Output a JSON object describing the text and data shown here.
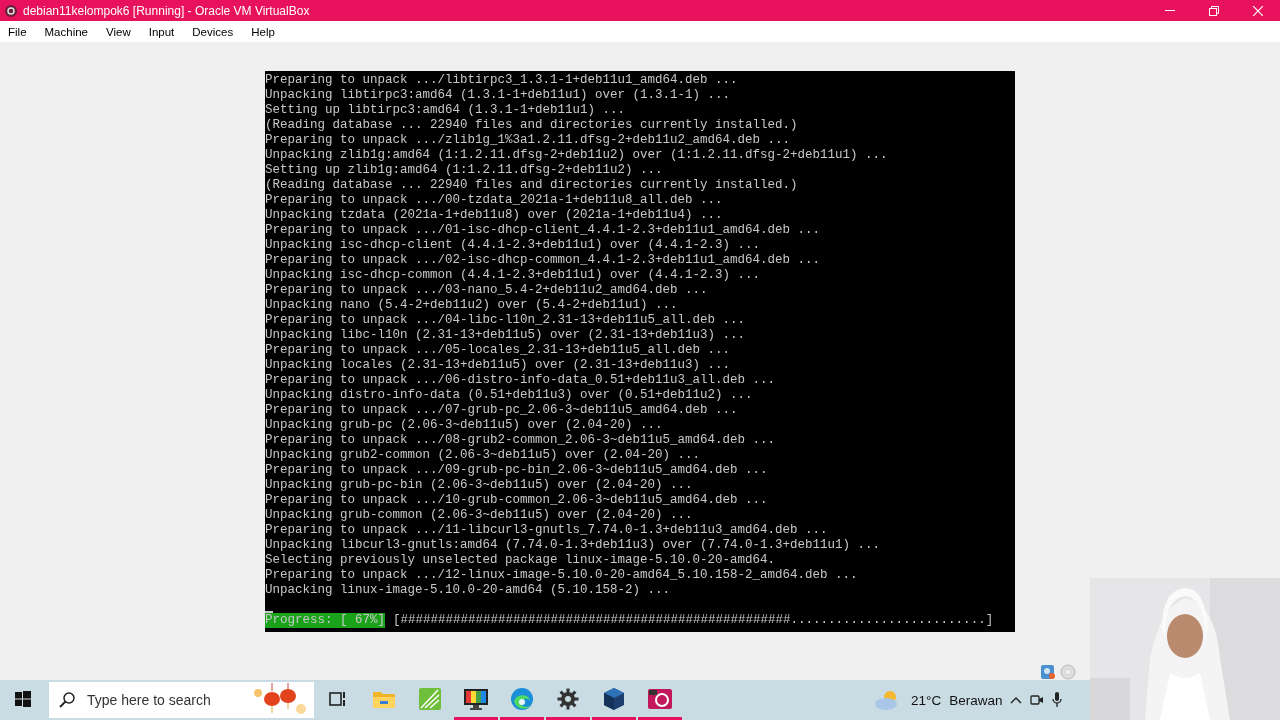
{
  "window": {
    "title": "debian11kelompok6 [Running] - Oracle VM VirtualBox"
  },
  "menu": [
    "File",
    "Machine",
    "View",
    "Input",
    "Devices",
    "Help"
  ],
  "terminal": {
    "lines": [
      "Preparing to unpack .../libtirpc3_1.3.1-1+deb11u1_amd64.deb ...",
      "Unpacking libtirpc3:amd64 (1.3.1-1+deb11u1) over (1.3.1-1) ...",
      "Setting up libtirpc3:amd64 (1.3.1-1+deb11u1) ...",
      "(Reading database ... 22940 files and directories currently installed.)",
      "Preparing to unpack .../zlib1g_1%3a1.2.11.dfsg-2+deb11u2_amd64.deb ...",
      "Unpacking zlib1g:amd64 (1:1.2.11.dfsg-2+deb11u2) over (1:1.2.11.dfsg-2+deb11u1) ...",
      "Setting up zlib1g:amd64 (1:1.2.11.dfsg-2+deb11u2) ...",
      "(Reading database ... 22940 files and directories currently installed.)",
      "Preparing to unpack .../00-tzdata_2021a-1+deb11u8_all.deb ...",
      "Unpacking tzdata (2021a-1+deb11u8) over (2021a-1+deb11u4) ...",
      "Preparing to unpack .../01-isc-dhcp-client_4.4.1-2.3+deb11u1_amd64.deb ...",
      "Unpacking isc-dhcp-client (4.4.1-2.3+deb11u1) over (4.4.1-2.3) ...",
      "Preparing to unpack .../02-isc-dhcp-common_4.4.1-2.3+deb11u1_amd64.deb ...",
      "Unpacking isc-dhcp-common (4.4.1-2.3+deb11u1) over (4.4.1-2.3) ...",
      "Preparing to unpack .../03-nano_5.4-2+deb11u2_amd64.deb ...",
      "Unpacking nano (5.4-2+deb11u2) over (5.4-2+deb11u1) ...",
      "Preparing to unpack .../04-libc-l10n_2.31-13+deb11u5_all.deb ...",
      "Unpacking libc-l10n (2.31-13+deb11u5) over (2.31-13+deb11u3) ...",
      "Preparing to unpack .../05-locales_2.31-13+deb11u5_all.deb ...",
      "Unpacking locales (2.31-13+deb11u5) over (2.31-13+deb11u3) ...",
      "Preparing to unpack .../06-distro-info-data_0.51+deb11u3_all.deb ...",
      "Unpacking distro-info-data (0.51+deb11u3) over (0.51+deb11u2) ...",
      "Preparing to unpack .../07-grub-pc_2.06-3~deb11u5_amd64.deb ...",
      "Unpacking grub-pc (2.06-3~deb11u5) over (2.04-20) ...",
      "Preparing to unpack .../08-grub2-common_2.06-3~deb11u5_amd64.deb ...",
      "Unpacking grub2-common (2.06-3~deb11u5) over (2.04-20) ...",
      "Preparing to unpack .../09-grub-pc-bin_2.06-3~deb11u5_amd64.deb ...",
      "Unpacking grub-pc-bin (2.06-3~deb11u5) over (2.04-20) ...",
      "Preparing to unpack .../10-grub-common_2.06-3~deb11u5_amd64.deb ...",
      "Unpacking grub-common (2.06-3~deb11u5) over (2.04-20) ...",
      "Preparing to unpack .../11-libcurl3-gnutls_7.74.0-1.3+deb11u3_amd64.deb ...",
      "Unpacking libcurl3-gnutls:amd64 (7.74.0-1.3+deb11u3) over (7.74.0-1.3+deb11u1) ...",
      "Selecting previously unselected package linux-image-5.10.0-20-amd64.",
      "Preparing to unpack .../12-linux-image-5.10.0-20-amd64_5.10.158-2_amd64.deb ...",
      "Unpacking linux-image-5.10.0-20-amd64 (5.10.158-2) ..."
    ],
    "progress_label": "Progress: [ 67%]",
    "progress_bar": "[####################################################..........................]"
  },
  "taskbar": {
    "search": {
      "placeholder": "Type here to search"
    },
    "apps": [
      {
        "kind": "taskview",
        "running": false
      },
      {
        "kind": "folder",
        "running": false
      },
      {
        "kind": "green",
        "running": false
      },
      {
        "kind": "monitor",
        "running": true
      },
      {
        "kind": "edge",
        "running": true
      },
      {
        "kind": "gear",
        "running": true
      },
      {
        "kind": "cube",
        "running": true
      },
      {
        "kind": "red",
        "running": true
      }
    ],
    "weather": {
      "temperature": "21°C",
      "condition": "Berawan"
    }
  }
}
